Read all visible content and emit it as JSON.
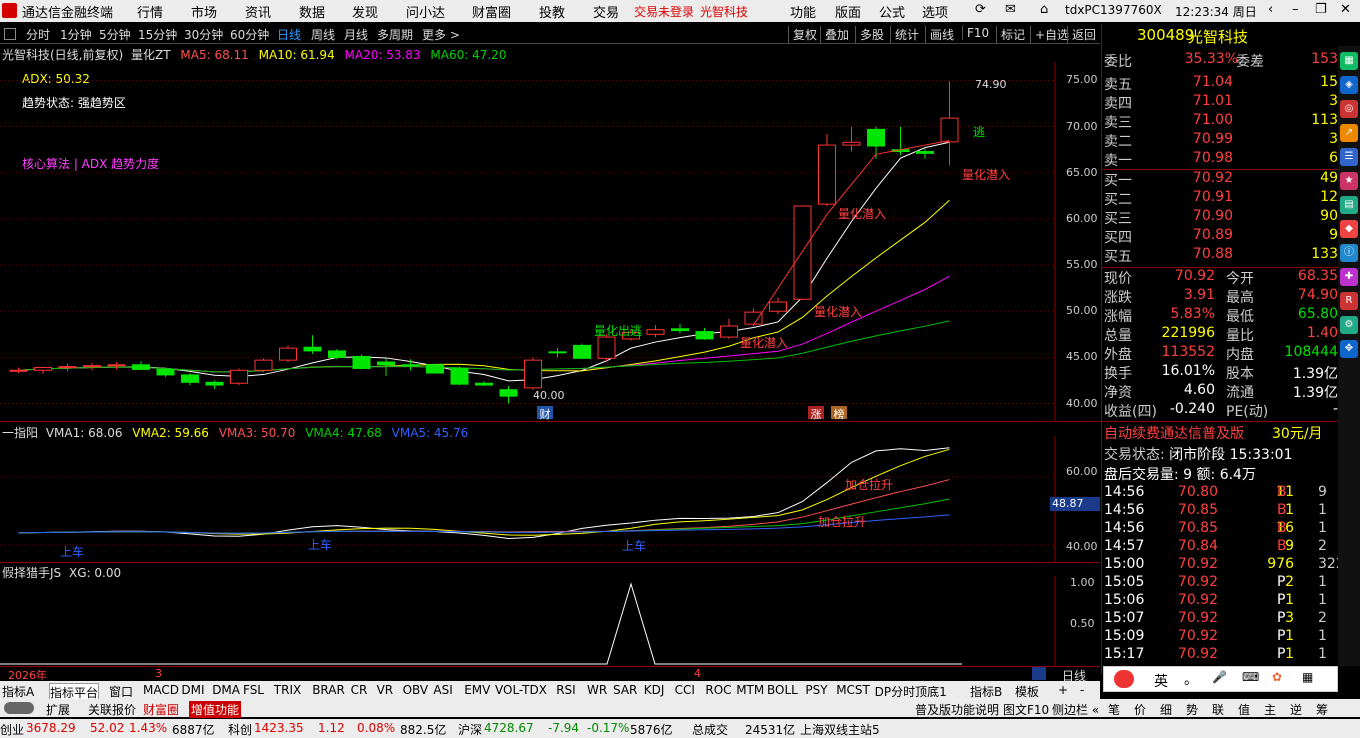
{
  "app": {
    "title": "通达信金融终端",
    "menus": [
      "行情",
      "市场",
      "资讯",
      "数据",
      "发现",
      "问小达",
      "财富圈",
      "投教",
      "交易"
    ],
    "trade_status": "交易未登录",
    "stock_name_menu": "光智科技",
    "right_menus": [
      "功能",
      "版面",
      "公式",
      "选项"
    ],
    "user": "tdxPC1397760X",
    "time": "12:23:34 周日"
  },
  "periods": [
    "分时",
    "1分钟",
    "5分钟",
    "15分钟",
    "30分钟",
    "60分钟",
    "日线",
    "周线",
    "月线",
    "多周期",
    "更多 >"
  ],
  "period_active": "日线",
  "chart_buttons": [
    "复权",
    "叠加",
    "多股",
    "统计",
    "画线",
    "F10",
    "标记",
    "+自选",
    "返回"
  ],
  "main_header": {
    "name": "光智科技(日线,前复权)",
    "indicator": "量化ZT",
    "ma5": "MA5: 68.11",
    "ma10": "MA10: 61.94",
    "ma20": "MA20: 53.83",
    "ma60": "MA60: 47.20"
  },
  "main_notes": {
    "adx": "ADX: 50.32",
    "trend": "趋势状态: 强趋势区",
    "algo": "核心算法 | ADX 趋势力度"
  },
  "main_axis": [
    "75.00",
    "70.00",
    "65.00",
    "60.00",
    "55.00",
    "50.00",
    "45.00",
    "40.00"
  ],
  "annotations": {
    "high": "74.90",
    "low": "40.00",
    "buy1": "量化潜入",
    "buy2": "量化潜入",
    "buy3": "量化潜入",
    "buy4": "量化潜入",
    "sell": "量化出逃",
    "sell2": "逃",
    "cai": "财",
    "zhang": "涨",
    "bang": "榜"
  },
  "vol_header": {
    "name": "一指阳",
    "vma1": "VMA1: 68.06",
    "vma2": "VMA2: 59.66",
    "vma3": "VMA3: 50.70",
    "vma4": "VMA4: 47.68",
    "vma5": "VMA5: 45.76"
  },
  "vol_axis": [
    "60.00",
    "40.00"
  ],
  "vol_marker": "48.87",
  "vol_notes": {
    "up1": "加仓拉升",
    "up2": "加仓拉升",
    "car1": "上车",
    "car2": "上车",
    "car3": "上车"
  },
  "ind3_header": {
    "name": "假择猎手JS",
    "xg": "XG: 0.00"
  },
  "ind3_axis": [
    "1.00",
    "0.50"
  ],
  "date_axis": {
    "y": "2026年",
    "m3": "3",
    "m4": "4"
  },
  "period_label": "日线",
  "quote": {
    "code": "300489",
    "name": "光智科技",
    "weibi_label": "委比",
    "weibi": "35.33%",
    "weicha_label": "委差",
    "weicha": "153",
    "sells": [
      {
        "l": "卖五",
        "p": "71.04",
        "v": "15"
      },
      {
        "l": "卖四",
        "p": "71.01",
        "v": "3"
      },
      {
        "l": "卖三",
        "p": "71.00",
        "v": "113"
      },
      {
        "l": "卖二",
        "p": "70.99",
        "v": "3"
      },
      {
        "l": "卖一",
        "p": "70.98",
        "v": "6"
      }
    ],
    "buys": [
      {
        "l": "买一",
        "p": "70.92",
        "v": "49"
      },
      {
        "l": "买二",
        "p": "70.91",
        "v": "12"
      },
      {
        "l": "买三",
        "p": "70.90",
        "v": "90"
      },
      {
        "l": "买四",
        "p": "70.89",
        "v": "9"
      },
      {
        "l": "买五",
        "p": "70.88",
        "v": "133"
      }
    ],
    "stats": [
      {
        "l1": "现价",
        "v1": "70.92",
        "l2": "今开",
        "v2": "68.35"
      },
      {
        "l1": "涨跌",
        "v1": "3.91",
        "l2": "最高",
        "v2": "74.90"
      },
      {
        "l1": "涨幅",
        "v1": "5.83%",
        "l2": "最低",
        "v2": "65.80"
      },
      {
        "l1": "总量",
        "v1": "221996",
        "l2": "量比",
        "v2": "1.40"
      },
      {
        "l1": "外盘",
        "v1": "113552",
        "l2": "内盘",
        "v2": "108444"
      },
      {
        "l1": "换手",
        "v1": "16.01%",
        "l2": "股本",
        "v2": "1.39亿"
      },
      {
        "l1": "净资",
        "v1": "4.60",
        "l2": "流通",
        "v2": "1.39亿"
      },
      {
        "l1": "收益(四)",
        "v1": "-0.240",
        "l2": "PE(动)",
        "v2": "-"
      }
    ]
  },
  "promo": {
    "text": "自动续费通达信普及版",
    "price": "30元/月"
  },
  "trade_status": {
    "label": "交易状态:",
    "value": "闭市阶段 15:33:01"
  },
  "after_vol": {
    "text": "盘后交易量: 9  额: 6.4万"
  },
  "ticks": [
    {
      "t": "14:56",
      "p": "70.80",
      "v": "11",
      "s": "B",
      "n": "9"
    },
    {
      "t": "14:56",
      "p": "70.85",
      "v": "1",
      "s": "B",
      "n": "1"
    },
    {
      "t": "14:56",
      "p": "70.85",
      "v": "16",
      "s": "B",
      "n": "1"
    },
    {
      "t": "14:57",
      "p": "70.84",
      "v": "9",
      "s": "B",
      "n": "2"
    },
    {
      "t": "15:00",
      "p": "70.92",
      "v": "976",
      "s": "",
      "n": "322"
    },
    {
      "t": "15:05",
      "p": "70.92",
      "v": "2",
      "s": "P",
      "n": "1"
    },
    {
      "t": "15:06",
      "p": "70.92",
      "v": "1",
      "s": "P",
      "n": "1"
    },
    {
      "t": "15:07",
      "p": "70.92",
      "v": "3",
      "s": "P",
      "n": "2"
    },
    {
      "t": "15:09",
      "p": "70.92",
      "v": "1",
      "s": "P",
      "n": "1"
    },
    {
      "t": "15:17",
      "p": "70.92",
      "v": "1",
      "s": "P",
      "n": "1"
    }
  ],
  "ind_tabs": [
    "指标A",
    "指标平台",
    "窗口",
    "MACD",
    "DMI",
    "DMA",
    "FSL",
    "TRIX",
    "BRAR",
    "CR",
    "VR",
    "OBV",
    "ASI",
    "EMV",
    "VOL-TDX",
    "RSI",
    "WR",
    "SAR",
    "KDJ",
    "CCI",
    "ROC",
    "MTM",
    "BOLL",
    "PSY",
    "MCST",
    "DP分时顶底1"
  ],
  "ind_tabs_right": [
    "指标B",
    "模板",
    "+",
    "-"
  ],
  "bottom2": [
    "扩展",
    "关联报价",
    "财富圈",
    "增值功能"
  ],
  "bottom2_right": [
    "普及版功能说明",
    "图文F10",
    "侧边栏 «"
  ],
  "quote_tabs": [
    "笔",
    "价",
    "细",
    "势",
    "联",
    "值",
    "主",
    "逆",
    "筹"
  ],
  "ime": [
    "英",
    "。"
  ],
  "status": [
    {
      "n": "创业",
      "v": "3678.29",
      "c": "52.02",
      "p": "1.43%",
      "a": "6887亿"
    },
    {
      "n": "科创",
      "v": "1423.35",
      "c": "1.12",
      "p": "0.08%",
      "a": "882.5亿"
    },
    {
      "n": "沪深",
      "v": "4728.67",
      "c": "-7.94",
      "p": "-0.17%",
      "a": "5876亿"
    }
  ],
  "total_label": "总成交",
  "total": "24531亿",
  "server": "上海双线主站5",
  "colors": {
    "up": "#ff3232",
    "down": "#00e600",
    "ma5": "#ffffff",
    "ma10": "#ffff00",
    "ma20": "#ff00ff",
    "ma60": "#00c000",
    "accent": "#39f"
  },
  "chart_data": {
    "type": "candlestick",
    "ylim": [
      38,
      77
    ],
    "candles": [
      [
        43.6,
        43.9,
        43.3,
        43.6
      ],
      [
        43.6,
        44.0,
        43.2,
        43.9
      ],
      [
        43.9,
        44.3,
        43.5,
        44.0
      ],
      [
        44.0,
        44.4,
        43.6,
        44.1
      ],
      [
        44.1,
        44.5,
        43.7,
        44.2
      ],
      [
        44.2,
        44.6,
        43.6,
        43.7
      ],
      [
        43.7,
        43.9,
        42.9,
        43.1
      ],
      [
        43.1,
        43.3,
        42.0,
        42.3
      ],
      [
        42.3,
        42.5,
        41.6,
        42.0
      ],
      [
        42.2,
        43.8,
        42.0,
        43.6
      ],
      [
        43.6,
        44.9,
        43.4,
        44.7
      ],
      [
        44.7,
        46.3,
        44.5,
        46.0
      ],
      [
        46.1,
        47.4,
        45.4,
        45.7
      ],
      [
        45.7,
        45.9,
        44.8,
        45.0
      ],
      [
        45.1,
        45.3,
        43.7,
        43.8
      ],
      [
        44.5,
        44.9,
        43.0,
        44.2
      ],
      [
        44.2,
        44.8,
        43.6,
        44.1
      ],
      [
        44.2,
        44.3,
        43.3,
        43.3
      ],
      [
        43.8,
        44.0,
        42.0,
        42.1
      ],
      [
        42.2,
        42.4,
        41.9,
        42.0
      ],
      [
        41.5,
        41.9,
        40.0,
        40.8
      ],
      [
        41.7,
        45.0,
        41.5,
        44.7
      ],
      [
        45.6,
        46.0,
        45.0,
        45.5
      ],
      [
        46.3,
        46.5,
        44.8,
        44.9
      ],
      [
        44.9,
        47.5,
        44.6,
        47.2
      ],
      [
        47.0,
        48.0,
        46.8,
        47.7
      ],
      [
        47.5,
        48.5,
        47.2,
        48.0
      ],
      [
        48.1,
        48.6,
        47.6,
        47.9
      ],
      [
        47.8,
        48.2,
        46.9,
        47.0
      ],
      [
        47.2,
        49.2,
        47.0,
        48.4
      ],
      [
        48.6,
        50.3,
        48.4,
        49.9
      ],
      [
        50.0,
        51.5,
        49.7,
        51.0
      ],
      [
        51.3,
        61.5,
        51.2,
        61.4
      ],
      [
        61.6,
        69.2,
        61.4,
        68.0
      ],
      [
        68.0,
        70.0,
        67.3,
        68.3
      ],
      [
        69.7,
        70.0,
        66.5,
        67.9
      ],
      [
        67.5,
        70.0,
        66.9,
        67.3
      ],
      [
        67.3,
        67.6,
        66.5,
        67.1
      ],
      [
        68.35,
        74.9,
        65.8,
        70.92
      ]
    ]
  }
}
